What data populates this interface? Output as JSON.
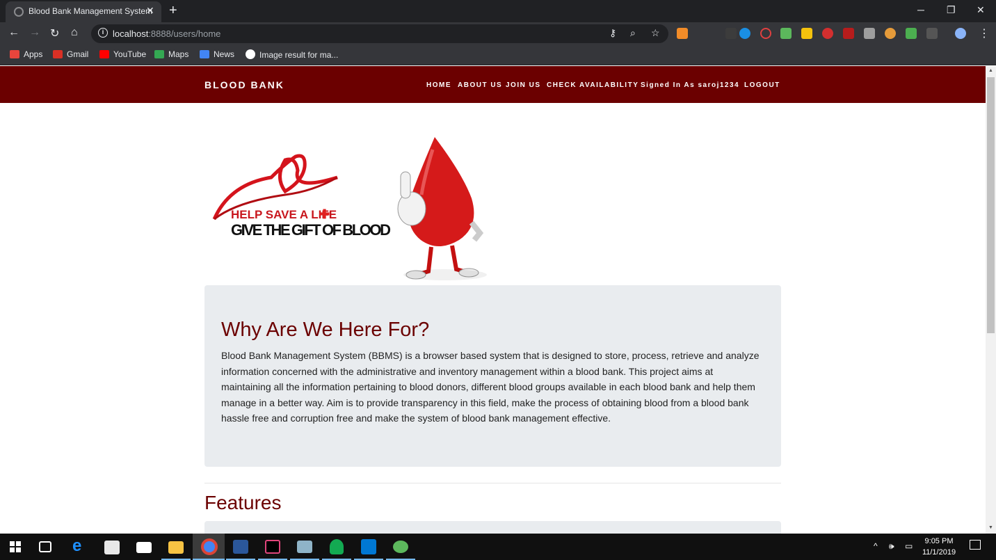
{
  "browser": {
    "tab_title": "Blood Bank Management System",
    "url_host": "localhost",
    "url_path": ":8888/users/home",
    "bookmarks": [
      {
        "label": "Apps",
        "icon": "apps-grid-icon",
        "color": "#e8453c"
      },
      {
        "label": "Gmail",
        "icon": "gmail-icon",
        "color": "#d93025"
      },
      {
        "label": "YouTube",
        "icon": "youtube-icon",
        "color": "#ff0000"
      },
      {
        "label": "Maps",
        "icon": "maps-icon",
        "color": "#34a853"
      },
      {
        "label": "News",
        "icon": "news-icon",
        "color": "#4285f4"
      },
      {
        "label": "Image result for ma...",
        "icon": "google-icon",
        "color": "#ffffff"
      }
    ]
  },
  "site": {
    "brand": "BLOOD BANK",
    "nav": {
      "home": "HOME",
      "about": "ABOUT US",
      "join": "JOIN US",
      "check": "CHECK AVAILABILITY",
      "signed_in": "Signed In As saroj1234",
      "logout": "LOGOUT"
    },
    "hero": {
      "line1": "HELP SAVE A LIFE",
      "line2": "GIVE THE GIFT OF BLOOD"
    },
    "about": {
      "title": "Why Are We Here For?",
      "text": "Blood Bank Management System (BBMS) is a browser based system that is designed to store, process, retrieve and analyze information concerned with the administrative and inventory management within a blood bank. This project aims at maintaining all the information pertaining to blood donors, different blood groups available in each blood bank and help them manage in a better way. Aim is to provide transparency in this field, make the process of obtaining blood from a blood bank hassle free and corruption free and make the system of blood bank management effective."
    },
    "features_title": "Features"
  },
  "taskbar": {
    "time": "9:05 PM",
    "date": "11/1/2019"
  },
  "colors": {
    "nav_bg": "#6b0000",
    "accent": "#6b0000",
    "card_bg": "#e9ecef"
  }
}
